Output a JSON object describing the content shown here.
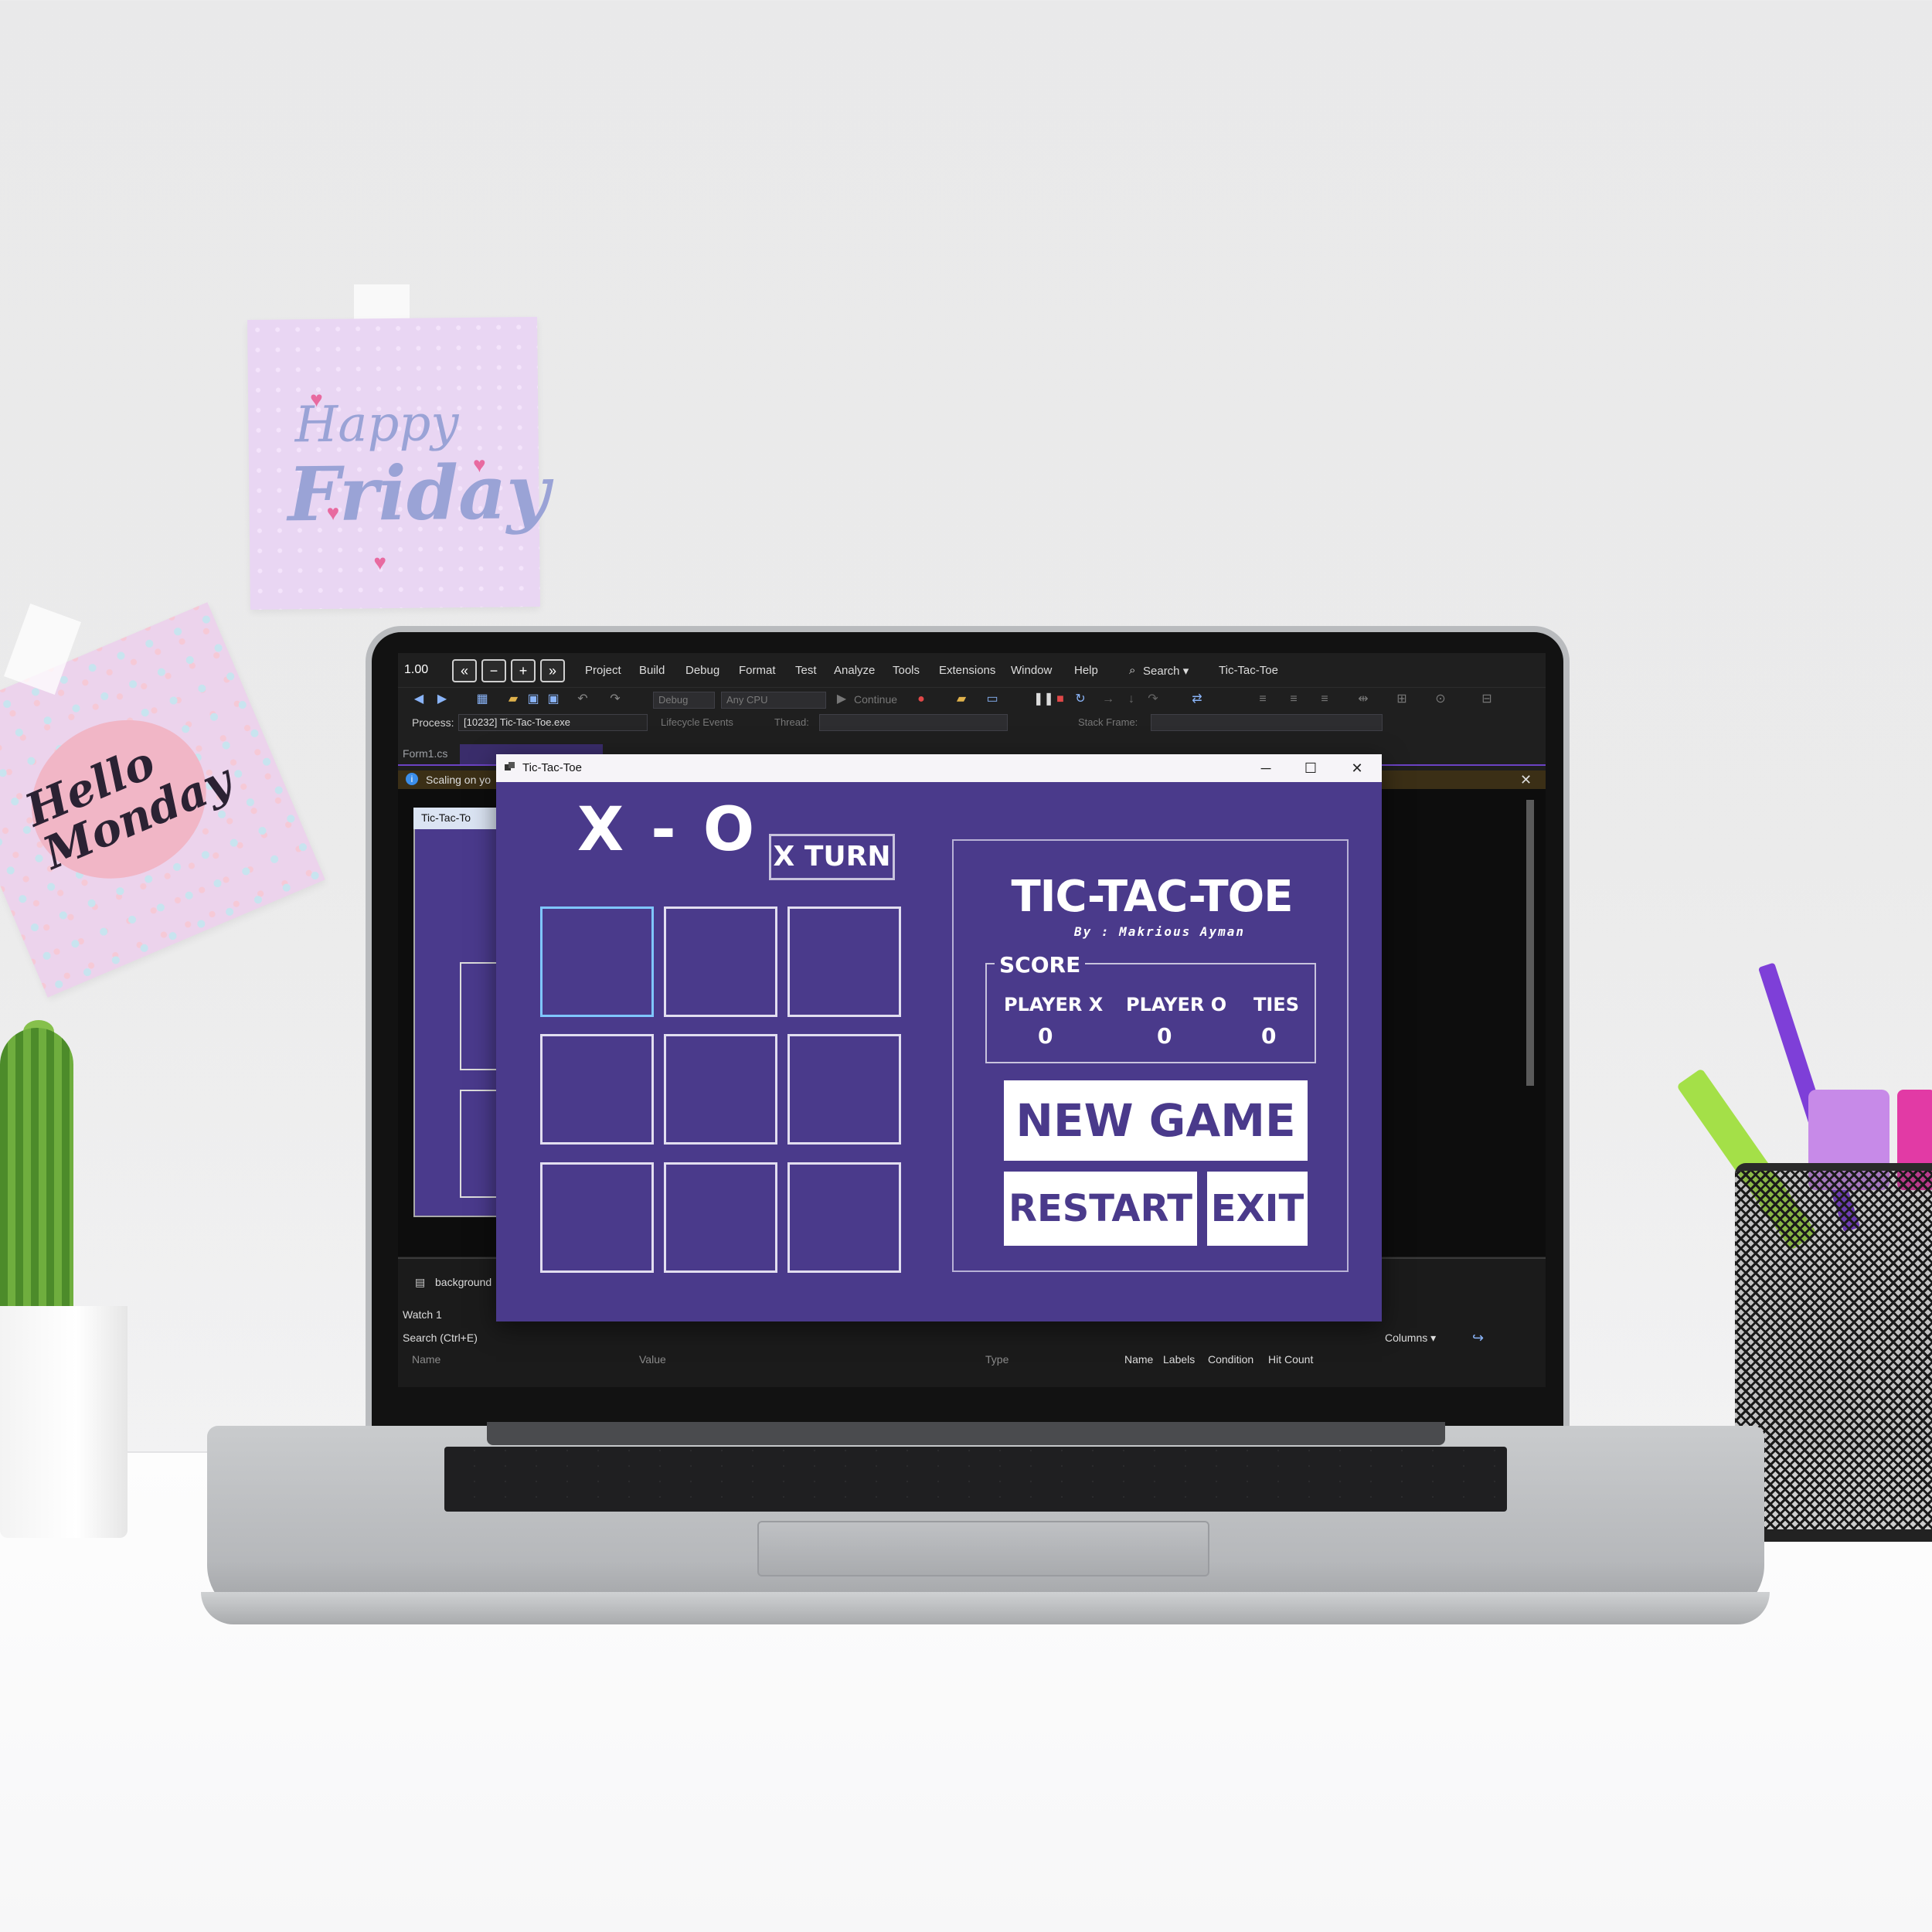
{
  "notes": {
    "friday_line1": "Happy",
    "friday_line2": "Friday",
    "monday_line1": "Hello",
    "monday_line2": "Monday"
  },
  "ide": {
    "zoom": "1.00",
    "zoom_buttons": [
      "«",
      "−",
      "+",
      "»"
    ],
    "menu": [
      "Project",
      "Build",
      "Debug",
      "Format",
      "Test",
      "Analyze",
      "Tools",
      "Extensions",
      "Window",
      "Help"
    ],
    "search_label": "Search ▾",
    "solution_name": "Tic-Tac-Toe",
    "config_debug": "Debug",
    "config_cpu": "Any CPU",
    "continue_label": "Continue",
    "process_label": "Process:",
    "process_value": "[10232] Tic-Tac-Toe.exe",
    "lifecycle_label": "Lifecycle Events",
    "thread_label": "Thread:",
    "stack_frame_label": "Stack Frame:",
    "tab_form_cs": "Form1.cs",
    "info_text": "Scaling on yo",
    "mini_form_title": "Tic-Tac-To",
    "component_label": "background",
    "watch_title": "Watch 1",
    "watch_search": "Search (Ctrl+E)",
    "watch_columns": [
      "Name",
      "Value",
      "Type"
    ],
    "breakpoint_columns": [
      "Name",
      "Labels",
      "Condition",
      "Hit Count"
    ],
    "columns_label": "Columns ▾"
  },
  "app": {
    "window_title": "Tic-Tac-Toe",
    "logo": "X - O",
    "turn_label": "X TURN",
    "board": [
      "",
      "",
      "",
      "",
      "",
      "",
      "",
      "",
      ""
    ],
    "game_title": "TIC-TAC-TOE",
    "byline": "By : Makrious Ayman",
    "score_legend": "SCORE",
    "score": {
      "player_x_label": "PLAYER X",
      "player_o_label": "PLAYER O",
      "ties_label": "TIES",
      "player_x": "0",
      "player_o": "0",
      "ties": "0"
    },
    "buttons": {
      "new_game": "NEW GAME",
      "restart": "RESTART",
      "exit": "EXIT"
    }
  }
}
